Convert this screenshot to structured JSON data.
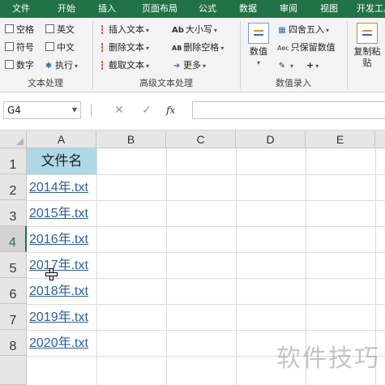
{
  "ribbon_tabs": [
    "文件",
    "开始",
    "插入",
    "页面布局",
    "公式",
    "数据",
    "审阅",
    "视图",
    "开发工具"
  ],
  "text_processing": {
    "checkboxes": [
      "空格",
      "英文",
      "符号",
      "中文",
      "数字"
    ],
    "execute_label": "执行",
    "group_label": "文本处理"
  },
  "advanced_text": {
    "insert_text": "插入文本",
    "delete_text": "删除文本",
    "extract_text": "截取文本",
    "case": "大小写",
    "delete_space": "删除空格",
    "more": "更多",
    "case_icon": "Ab",
    "delete_space_icon": "AB",
    "group_label": "高级文本处理"
  },
  "numeric_entry": {
    "value_btn": "数值",
    "round": "四舍五入",
    "keep_value": "只保留数值",
    "keep_value_icon": "Aec",
    "plus_btn": "+",
    "group_label": "数值录入"
  },
  "paste": {
    "line1": "复制粘",
    "line2": "贴"
  },
  "formula_bar": {
    "cell_ref": "G4",
    "fx": "fx"
  },
  "columns": [
    "A",
    "B",
    "C",
    "D",
    "E"
  ],
  "rows": [
    "1",
    "2",
    "3",
    "4",
    "5",
    "6",
    "7",
    "8"
  ],
  "header_cell": "文件名",
  "files": [
    "2014年.txt",
    "2015年.txt",
    "2016年.txt",
    "2017年.txt",
    "2018年.txt",
    "2019年.txt",
    "2020年.txt"
  ],
  "watermark": "软件技巧",
  "colors": {
    "ribbon_green": "#217346",
    "header_fill": "#add8e6",
    "link": "#2e5f9e"
  }
}
